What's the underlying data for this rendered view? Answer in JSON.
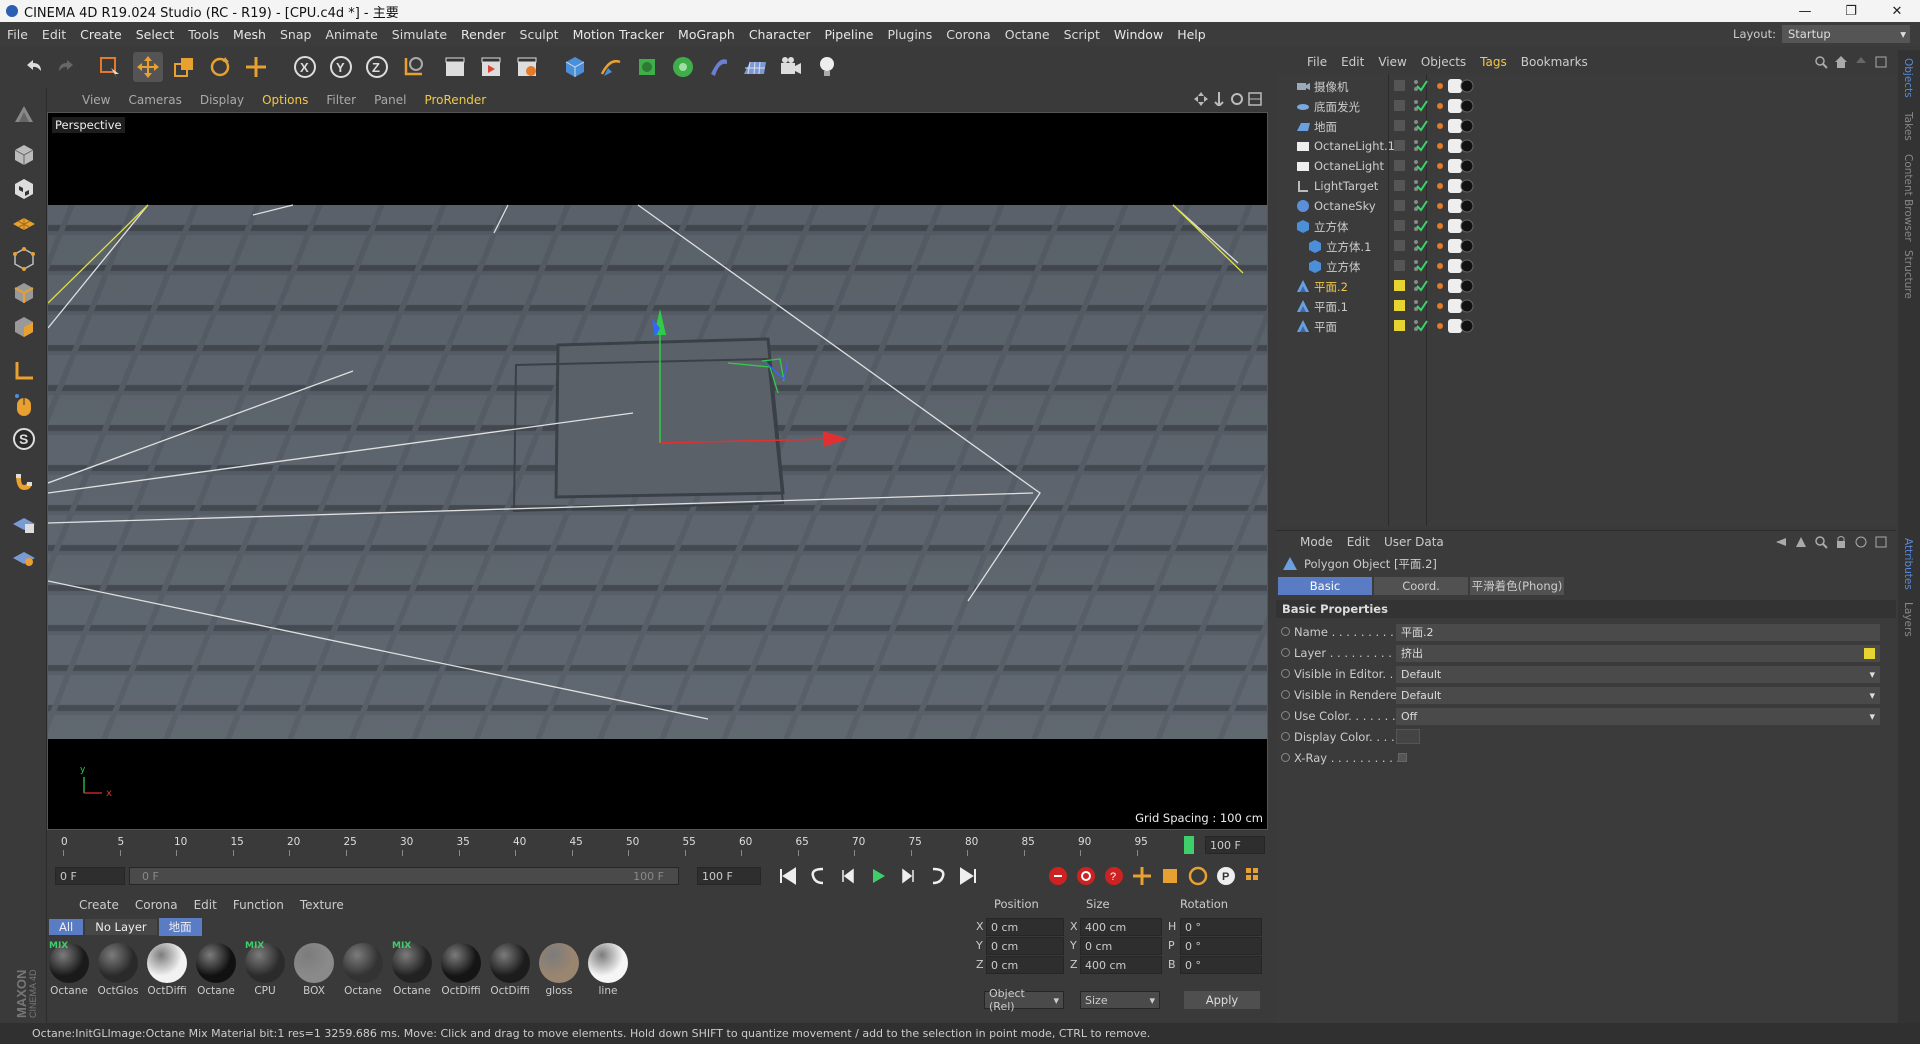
{
  "window": {
    "title": "CINEMA 4D R19.024 Studio (RC - R19) - [CPU.c4d *] - 主要",
    "buttons": [
      "—",
      "❐",
      "✕"
    ]
  },
  "menu": [
    "File",
    "Edit",
    "Create",
    "Select",
    "Tools",
    "Mesh",
    "Snap",
    "Animate",
    "Simulate",
    "Render",
    "Sculpt",
    "Motion Tracker",
    "MoGraph",
    "Character",
    "Pipeline",
    "Plugins",
    "Corona",
    "Octane",
    "Script",
    "Window",
    "Help"
  ],
  "layout": {
    "label": "Layout:",
    "value": "Startup"
  },
  "viewport_menu": [
    "View",
    "Cameras",
    "Display",
    "Options",
    "Filter",
    "Panel",
    "ProRender"
  ],
  "viewport": {
    "name": "Perspective",
    "grid_spacing": "Grid Spacing : 100 cm",
    "axis_x": "x",
    "axis_y": "y"
  },
  "timeline": {
    "ticks": [
      "0",
      "5",
      "10",
      "15",
      "20",
      "25",
      "30",
      "35",
      "40",
      "45",
      "50",
      "55",
      "60",
      "65",
      "70",
      "75",
      "80",
      "85",
      "90",
      "95"
    ],
    "end_field": "100 F"
  },
  "transport": {
    "current": "0 F",
    "start": "0 F",
    "range_end": "100 F",
    "end": "100 F"
  },
  "materials": {
    "tabs": [
      "Create",
      "Corona",
      "Edit",
      "Function",
      "Texture"
    ],
    "filters": [
      "All",
      "No Layer",
      "地面"
    ],
    "items": [
      {
        "label": "Octane",
        "color": "#1a1a1a",
        "mix": true
      },
      {
        "label": "OctGlos",
        "color": "#2a2a2a",
        "mix": false
      },
      {
        "label": "OctDiffi",
        "color": "#f2f2f2",
        "mix": false
      },
      {
        "label": "Octane",
        "color": "#111111",
        "mix": false
      },
      {
        "label": "CPU",
        "color": "#2b2b2b",
        "mix": true
      },
      {
        "label": "BOX",
        "color": "#8a8a8a",
        "mix": false
      },
      {
        "label": "Octane",
        "color": "#333333",
        "mix": false
      },
      {
        "label": "Octane",
        "color": "#222222",
        "mix": true
      },
      {
        "label": "OctDiffi",
        "color": "#151515",
        "mix": false
      },
      {
        "label": "OctDiffi",
        "color": "#1c1c1c",
        "mix": false
      },
      {
        "label": "gloss",
        "color": "#9a8570",
        "mix": false
      },
      {
        "label": "line",
        "color": "#f5f5f5",
        "mix": false
      }
    ]
  },
  "coords": {
    "headers": [
      "Position",
      "Size",
      "Rotation"
    ],
    "rows": [
      {
        "axis": "X",
        "pos": "0 cm",
        "size_axis": "X",
        "size": "400 cm",
        "rot_axis": "H",
        "rot": "0 °"
      },
      {
        "axis": "Y",
        "pos": "0 cm",
        "size_axis": "Y",
        "size": "0 cm",
        "rot_axis": "P",
        "rot": "0 °"
      },
      {
        "axis": "Z",
        "pos": "0 cm",
        "size_axis": "Z",
        "size": "400 cm",
        "rot_axis": "B",
        "rot": "0 °"
      }
    ],
    "mode": "Object (Rel)",
    "size_mode": "Size",
    "apply": "Apply"
  },
  "status": "Octane:InitGLImage:Octane Mix Material  bit:1 res=1  3259.686 ms.  Move: Click and drag to move elements. Hold down SHIFT to quantize movement / add to the selection in point mode, CTRL to remove.",
  "object_menu": [
    "File",
    "Edit",
    "View",
    "Objects",
    "Tags",
    "Bookmarks"
  ],
  "objects": [
    {
      "name": "摄像机",
      "icon": "camera",
      "indent": 0,
      "selected": false
    },
    {
      "name": "底面发光",
      "icon": "disc",
      "indent": 0,
      "selected": false
    },
    {
      "name": "地面",
      "icon": "floor",
      "indent": 0,
      "selected": false
    },
    {
      "name": "OctaneLight.1",
      "icon": "rect",
      "indent": 0,
      "selected": false
    },
    {
      "name": "OctaneLight",
      "icon": "rect",
      "indent": 0,
      "selected": false
    },
    {
      "name": "LightTarget",
      "icon": "target",
      "indent": 0,
      "selected": false
    },
    {
      "name": "OctaneSky",
      "icon": "sky",
      "indent": 0,
      "selected": false
    },
    {
      "name": "立方体",
      "icon": "cube",
      "indent": 0,
      "selected": false
    },
    {
      "name": "立方体.1",
      "icon": "cube",
      "indent": 1,
      "selected": false
    },
    {
      "name": "立方体",
      "icon": "cube",
      "indent": 1,
      "selected": false
    },
    {
      "name": "平面.2",
      "icon": "poly",
      "indent": 0,
      "selected": true
    },
    {
      "name": "平面.1",
      "icon": "poly",
      "indent": 0,
      "selected": false
    },
    {
      "name": "平面",
      "icon": "poly",
      "indent": 0,
      "selected": false
    }
  ],
  "attributes": {
    "menu": [
      "Mode",
      "Edit",
      "User Data"
    ],
    "object_title": "Polygon Object [平面.2]",
    "tabs": [
      "Basic",
      "Coord.",
      "平滑着色(Phong)"
    ],
    "section": "Basic Properties",
    "rows": [
      {
        "label": "Name . . . . . . . . . . .",
        "value": "平面.2"
      },
      {
        "label": "Layer . . . . . . . . . . .",
        "value": "挤出"
      },
      {
        "label": "Visible in Editor. . .",
        "value": "Default"
      },
      {
        "label": "Visible in Renderer",
        "value": "Default"
      },
      {
        "label": "Use Color. . . . . . . .",
        "value": "Off"
      },
      {
        "label": "Display Color. . . .",
        "value": ""
      },
      {
        "label": "X-Ray . . . . . . . . . .",
        "value": ""
      }
    ]
  },
  "side_tabs": [
    "Objects",
    "Takes",
    "Content Browser",
    "Structure",
    "Attributes",
    "Layers"
  ]
}
